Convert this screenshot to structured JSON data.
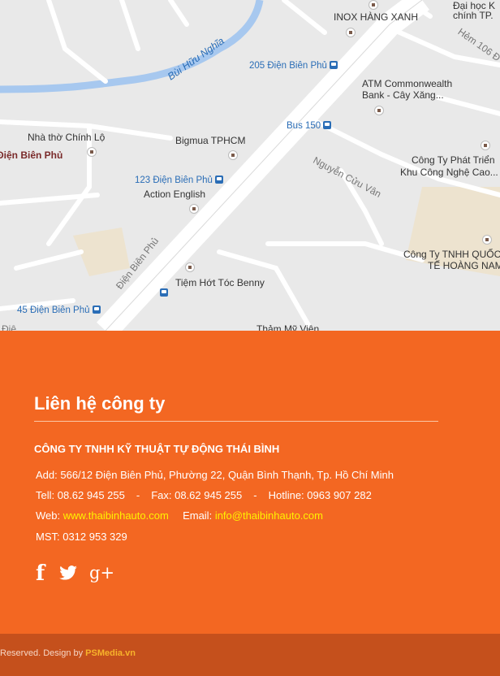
{
  "map": {
    "labels": {
      "university": "Đại học K",
      "university2": "chính TP.",
      "inox": "INOX HÀNG XANH",
      "stop205": "205 Điện Biên Phủ",
      "atm1": "ATM Commonwealth",
      "atm2": "Bank - Cây Xăng...",
      "bus150": "Bus 150",
      "church": "Nhà thờ Chính Lộ",
      "dbp_left": "Điện Biên Phủ",
      "bigmua": "Bigmua TPHCM",
      "stop123": "123 Điện Biên Phủ",
      "action": "Action English",
      "phat1": "Công Ty Phát Triển",
      "phat2": "Khu Công Nghệ Cao...",
      "quoc1": "Công Ty TNHH QUỐC",
      "quoc2": "TẾ HOÀNG NAM",
      "benny": "Tiệm Hớt Tóc Benny",
      "stop45": "45 Điện Biên Phủ",
      "tham": "Thảm Mỹ Viện",
      "road_dbp": "Điện Biên Phủ",
      "road_ncv": "Nguyễn Cửu Vân",
      "road_hem": "Hẻm 106 Đ",
      "river": "Bùi Hữu Nghĩa",
      "die": "Điệ"
    }
  },
  "contact": {
    "title": "Liên hệ công ty",
    "company": "CÔNG TY TNHH KỸ THUẬT TỰ ĐỘNG THÁI BÌNH",
    "address": "Add: 566/12 Điện Biên Phủ, Phường 22, Quận Bình Thạnh, Tp. Hồ Chí Minh",
    "tel": "Tell: 08.62 945 255",
    "fax": "Fax: 08.62 945 255",
    "hotline": "Hotline: 0963 907 282",
    "dash": "-",
    "web_label": "Web:",
    "web_url": "www.thaibinhauto.com",
    "email_label": "Email:",
    "email": "info@thaibinhauto.com",
    "mst": "MST: 0312 953 329",
    "social": {
      "facebook": "f",
      "twitter_icon": "twitter-icon",
      "gplus": "g+"
    }
  },
  "footer": {
    "copyright": "Reserved. Design by",
    "brand": "PSMedia.vn"
  }
}
